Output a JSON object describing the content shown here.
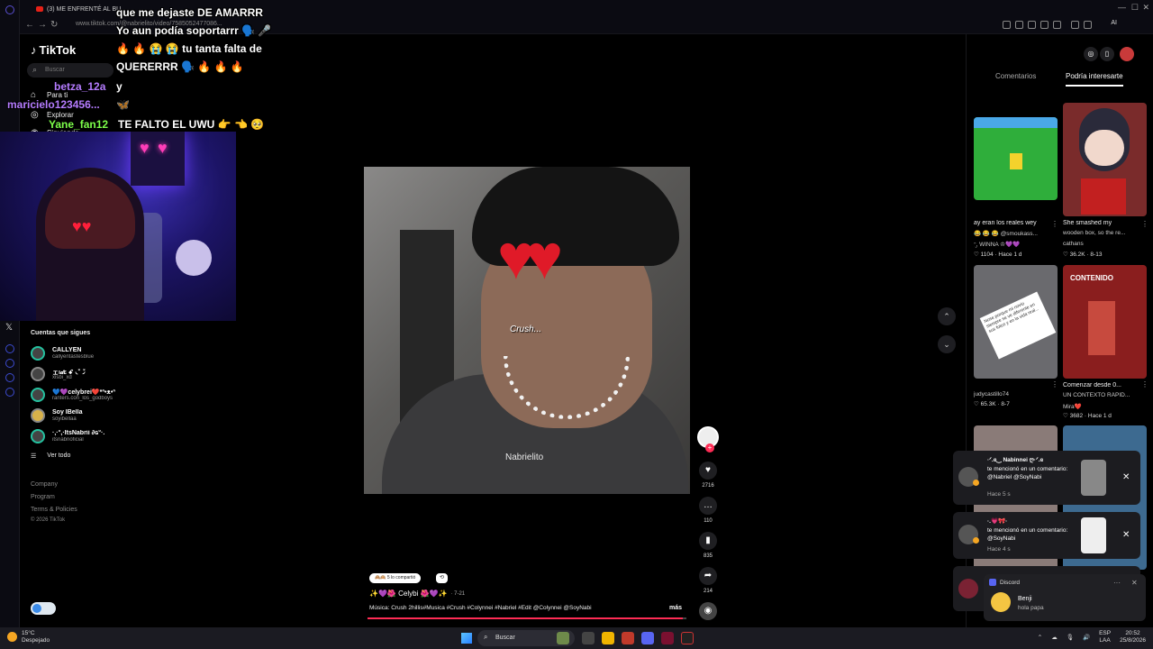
{
  "browser": {
    "tab_title": "(3) ME ENFRENTÉ AL BU...",
    "url": "www.tiktok.com/@nabrielito/video/7585052477086...",
    "ai_label": "AI"
  },
  "tiktok": {
    "logo": "TikTok",
    "search_placeholder": "Buscar",
    "nav": [
      {
        "label": "Para ti",
        "icon": "home-icon"
      },
      {
        "label": "Explorar",
        "icon": "compass-icon"
      },
      {
        "label": "Siguiendo",
        "icon": "following-icon"
      }
    ],
    "following_title": "Cuentas que sigues",
    "following": [
      {
        "name": "CALLYEN",
        "handle": "callyentastesblue"
      },
      {
        "name": "ェι𝒹ɛ ꗃ ◟̽◞̽",
        "handle": "xisbi_xd"
      },
      {
        "name": "💙💜celybrei❤️*ᐢ•ᴥ•ᐢ",
        "handle": "ranters.con_los_godboys"
      },
      {
        "name": "Soy IBella",
        "handle": "soyibellaa"
      },
      {
        "name": "·‚·°,·ItsNabrii ∂ɢ°·.",
        "handle": "itsnabrioficial"
      }
    ],
    "see_all": "Ver todo",
    "footer": [
      "Company",
      "Program",
      "Terms & Policies"
    ],
    "copyright": "© 2026 TikTok"
  },
  "chat": [
    {
      "user": "",
      "msg": "que me dejaste DE AMARRR"
    },
    {
      "user": "",
      "msg": "Yo aun podía soportarrr 🗣️ 🎤"
    },
    {
      "user": "",
      "msg": "🔥 🔥 😭 😭 tu tanta falta de"
    },
    {
      "user": "",
      "msg": "QUERERRR 🗣️ 🔥 🔥 🔥"
    },
    {
      "user": "betza_12a",
      "msg": "y",
      "color": "#b57cff"
    },
    {
      "user": "maricielo123456...",
      "msg": "🦋",
      "color": "#b57cff"
    },
    {
      "user": "Yane_fan12",
      "msg": "TE FALTO EL UWU 👉 👈 🥺",
      "color": "#7dff4a"
    }
  ],
  "video": {
    "caption": "Crush...",
    "watermark": "Nabrielito",
    "likes": "2716",
    "comments": "110",
    "saves": "835",
    "shares": "214",
    "shared_chip": "🙈🙉 5 lo compartió",
    "repost_chip": "⟲",
    "author": "✨💜🌺 Celybi 🌺💜✨",
    "date": "· 7-21",
    "description": "Música: Crush 2hillis#Musica #Crush #Colynnei #Nabriel #Edit @Colynnei @SoyNabi",
    "more": "más",
    "progress": 0.99
  },
  "right_panel": {
    "tabs": [
      "Comentarios",
      "Podría interesarte"
    ],
    "active_tab": "Podría interesarte",
    "cards": [
      {
        "caption": "ay eran los reales wey",
        "sub": "😂 😂 😂 @smoukass...",
        "sub2": "ᵔ̮, WINNA ♔💜💜",
        "likes": "1104",
        "age": "Hace 1 d",
        "bg": "#2fae3b"
      },
      {
        "caption": "She smashed my",
        "sub": "wooden box, so the re...",
        "sub2": "cathans",
        "likes": "36.2K",
        "age": "8-13",
        "bg": "#7a2b2b"
      },
      {
        "caption": "",
        "sub": "",
        "sub2": "judycastillo74",
        "likes": "65.3K",
        "age": "8-7",
        "bg": "#6a6a6e",
        "overlay": "Nose porque mi novio siempre se ve diferente en sus fotos y en la vida real..."
      },
      {
        "caption": "Comenzar desde 0...",
        "sub": "UN CONTEXTO RÁPID...",
        "sub2": "Mira❤️",
        "likes": "3682",
        "age": "Hace 1 d",
        "bg": "#8a1e1e",
        "overlay": "CONTENIDO"
      }
    ]
  },
  "notifications": [
    {
      "title": "·ᐟ.ɞ‿ Nabinnei ღ·ᐟ.ɞ",
      "msg": "te mencionó en un comentario: @Nabriel @SoyNabi",
      "time": "Hace 5 s"
    },
    {
      "title": "·.💗🎀·",
      "msg": "te mencionó en un comentario: @SoyNabi",
      "time": "Hace 4 s"
    }
  ],
  "discord": {
    "app": "Discord",
    "user": "Benji",
    "msg": "hola papa"
  },
  "taskbar": {
    "temp": "15°C",
    "weather": "Despejado",
    "search": "Buscar",
    "lang": "ESP",
    "region": "LAA",
    "time": "20:52",
    "date": "25/8/2026"
  }
}
